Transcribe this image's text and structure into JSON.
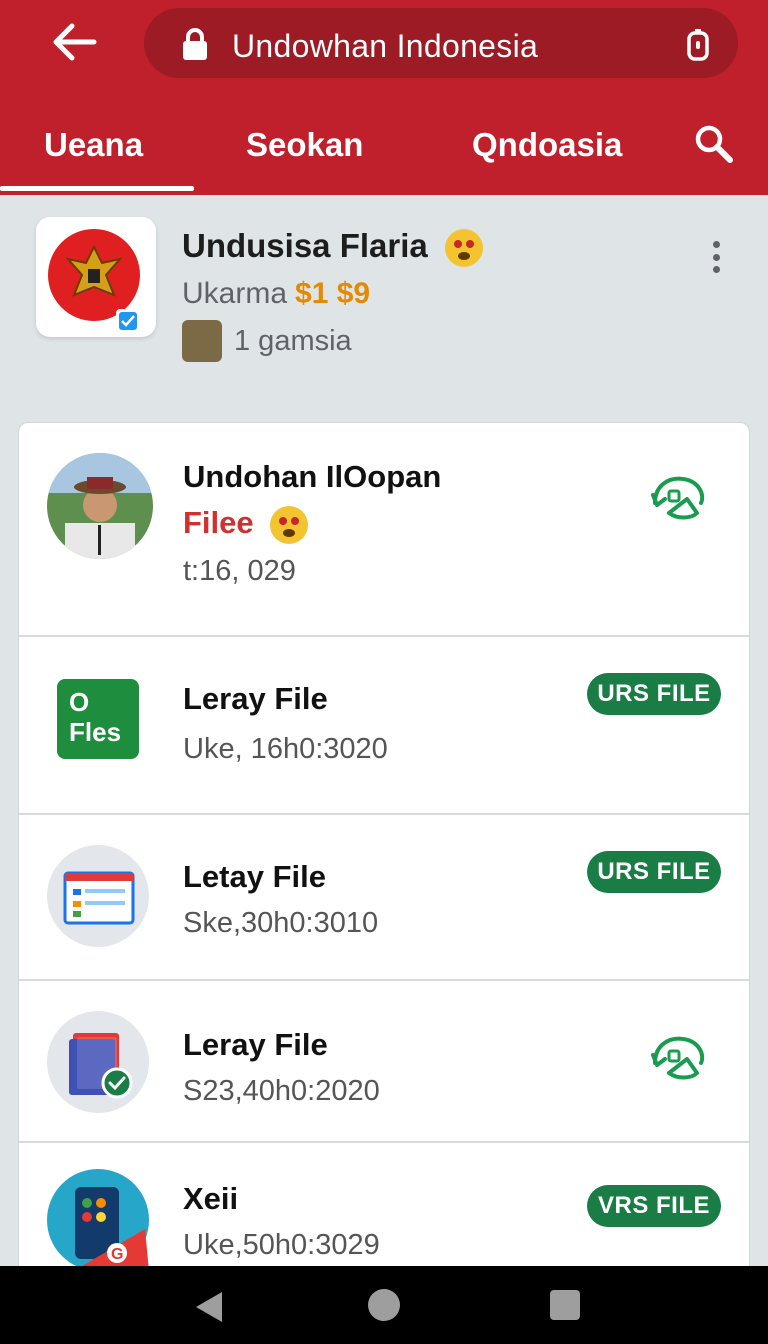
{
  "header": {
    "title": "Undowhan Indonesia",
    "back_icon": "arrow-left-icon",
    "lock_icon": "lock-icon",
    "tabs_icon": "tabs-icon"
  },
  "tabs": [
    {
      "label": "Ueana",
      "active": true
    },
    {
      "label": "Seokan",
      "active": false
    },
    {
      "label": "Qndoasia",
      "active": false
    }
  ],
  "profile": {
    "name": "Undusisa Flaria",
    "subtitle": "Ukarma",
    "price": "$1 $9",
    "meta": "1 gamsia"
  },
  "list": [
    {
      "title": "Undohan IlOopan",
      "highlight": "Filee",
      "sub": "t:16, 029",
      "action": "refresh-phone-icon"
    },
    {
      "title": "Leray File",
      "sub": "Uke, 16h0:3020",
      "badge": "URS FILE",
      "icon_text_top": "O",
      "icon_text_bottom": "Fles"
    },
    {
      "title": "Letay File",
      "sub": "Ske,30h0:3010",
      "badge": "URS FILE"
    },
    {
      "title": "Leray File",
      "sub": "S23,40h0:2020",
      "action": "refresh-phone-icon"
    },
    {
      "title": "Xeii",
      "sub": "Uke,50h0:3029",
      "badge": "VRS FILE"
    }
  ],
  "colors": {
    "primary": "#c0202b",
    "primary_dark": "#9c1b24",
    "accent_green": "#1a7d46",
    "price_orange": "#e58a00",
    "highlight_red": "#d32f2f"
  }
}
